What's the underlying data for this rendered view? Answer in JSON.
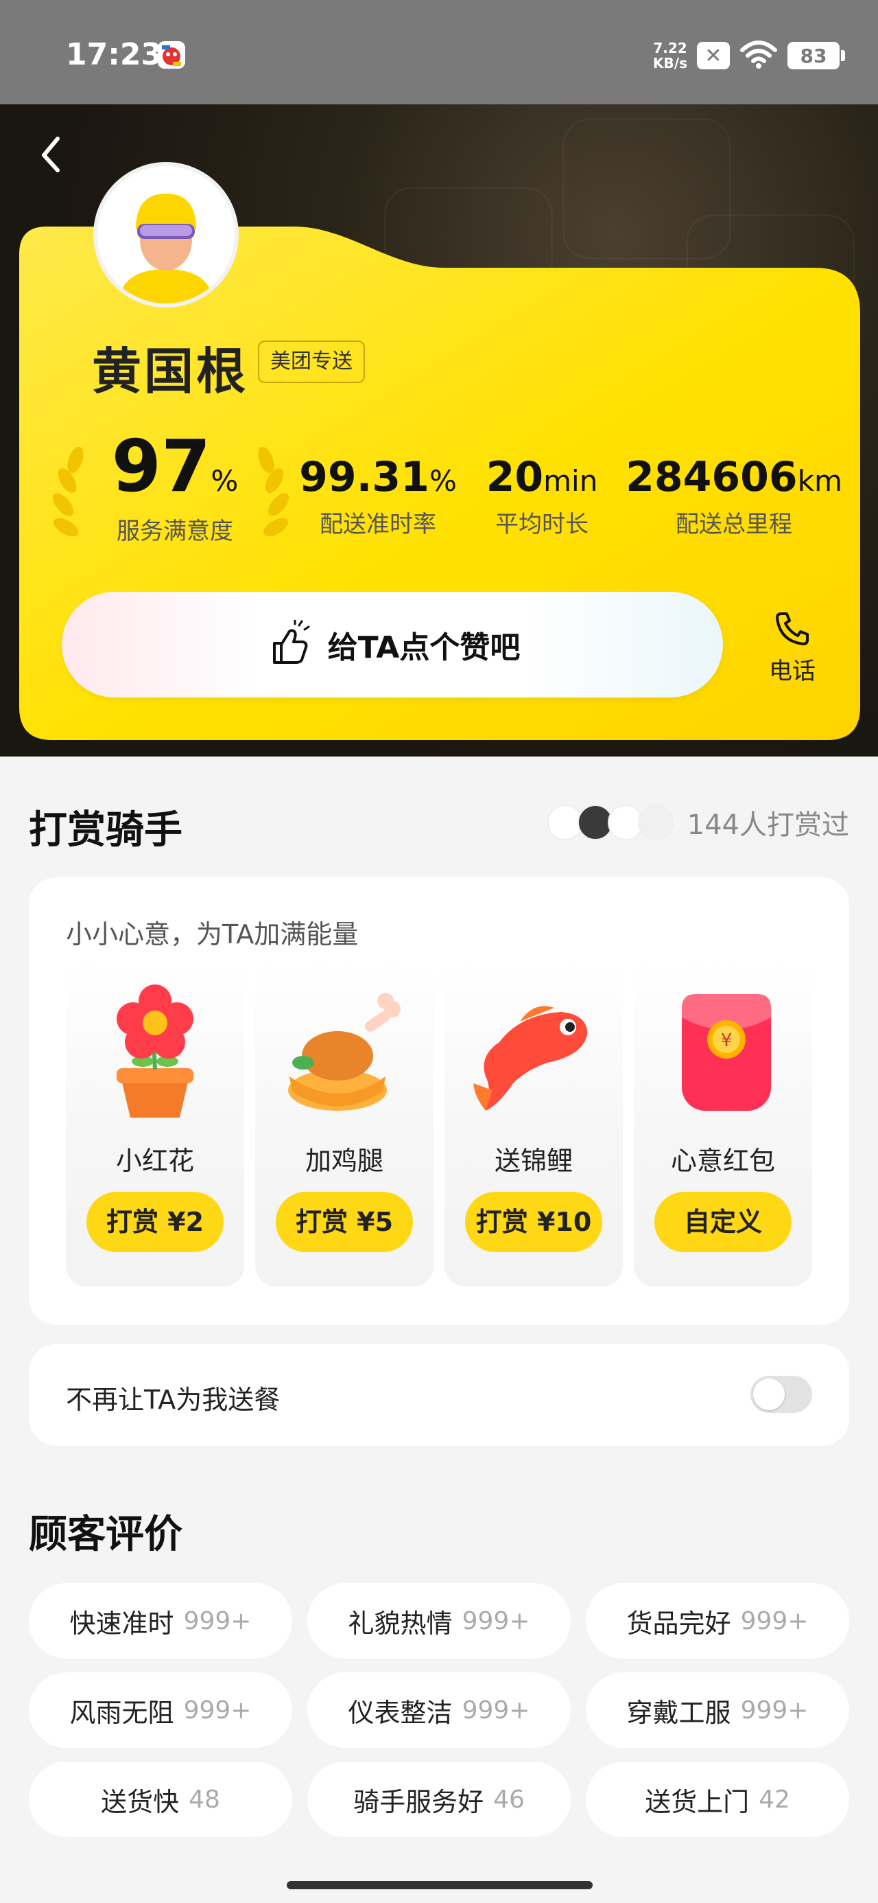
{
  "status": {
    "time": "17:23",
    "speed_value": "7.22",
    "speed_unit": "KB/s",
    "battery": "83",
    "sim": "✕"
  },
  "rider": {
    "name": "黄国根",
    "tag": "美团专送"
  },
  "stats": [
    {
      "value": "97",
      "unit": "%",
      "label": "服务满意度"
    },
    {
      "value": "99.31",
      "unit": "%",
      "label": "配送准时率"
    },
    {
      "value": "20",
      "unit": "min",
      "label": "平均时长"
    },
    {
      "value": "284606",
      "unit": "km",
      "label": "配送总里程"
    }
  ],
  "actions": {
    "like_label": "给TA点个赞吧",
    "phone_label": "电话"
  },
  "tip": {
    "title": "打赏骑手",
    "count_label": "144人打赏过",
    "subtitle": "小小心意，为TA加满能量",
    "gifts": [
      {
        "name": "小红花",
        "button": "打赏 ¥2",
        "icon": "flower-icon"
      },
      {
        "name": "加鸡腿",
        "button": "打赏 ¥5",
        "icon": "chicken-leg-icon"
      },
      {
        "name": "送锦鲤",
        "button": "打赏 ¥10",
        "icon": "koi-fish-icon"
      },
      {
        "name": "心意红包",
        "button": "自定义",
        "icon": "red-envelope-icon"
      }
    ]
  },
  "block": {
    "label": "不再让TA为我送餐",
    "enabled": false
  },
  "reviews": {
    "title": "顾客评价",
    "tags": [
      {
        "text": "快速准时",
        "count": "999+"
      },
      {
        "text": "礼貌热情",
        "count": "999+"
      },
      {
        "text": "货品完好",
        "count": "999+"
      },
      {
        "text": "风雨无阻",
        "count": "999+"
      },
      {
        "text": "仪表整洁",
        "count": "999+"
      },
      {
        "text": "穿戴工服",
        "count": "999+"
      },
      {
        "text": "送货快",
        "count": "48"
      },
      {
        "text": "骑手服务好",
        "count": "46"
      },
      {
        "text": "送货上门",
        "count": "42"
      }
    ]
  },
  "colors": {
    "brand_yellow": "#ffd815",
    "hero_dark": "#1a1610"
  }
}
